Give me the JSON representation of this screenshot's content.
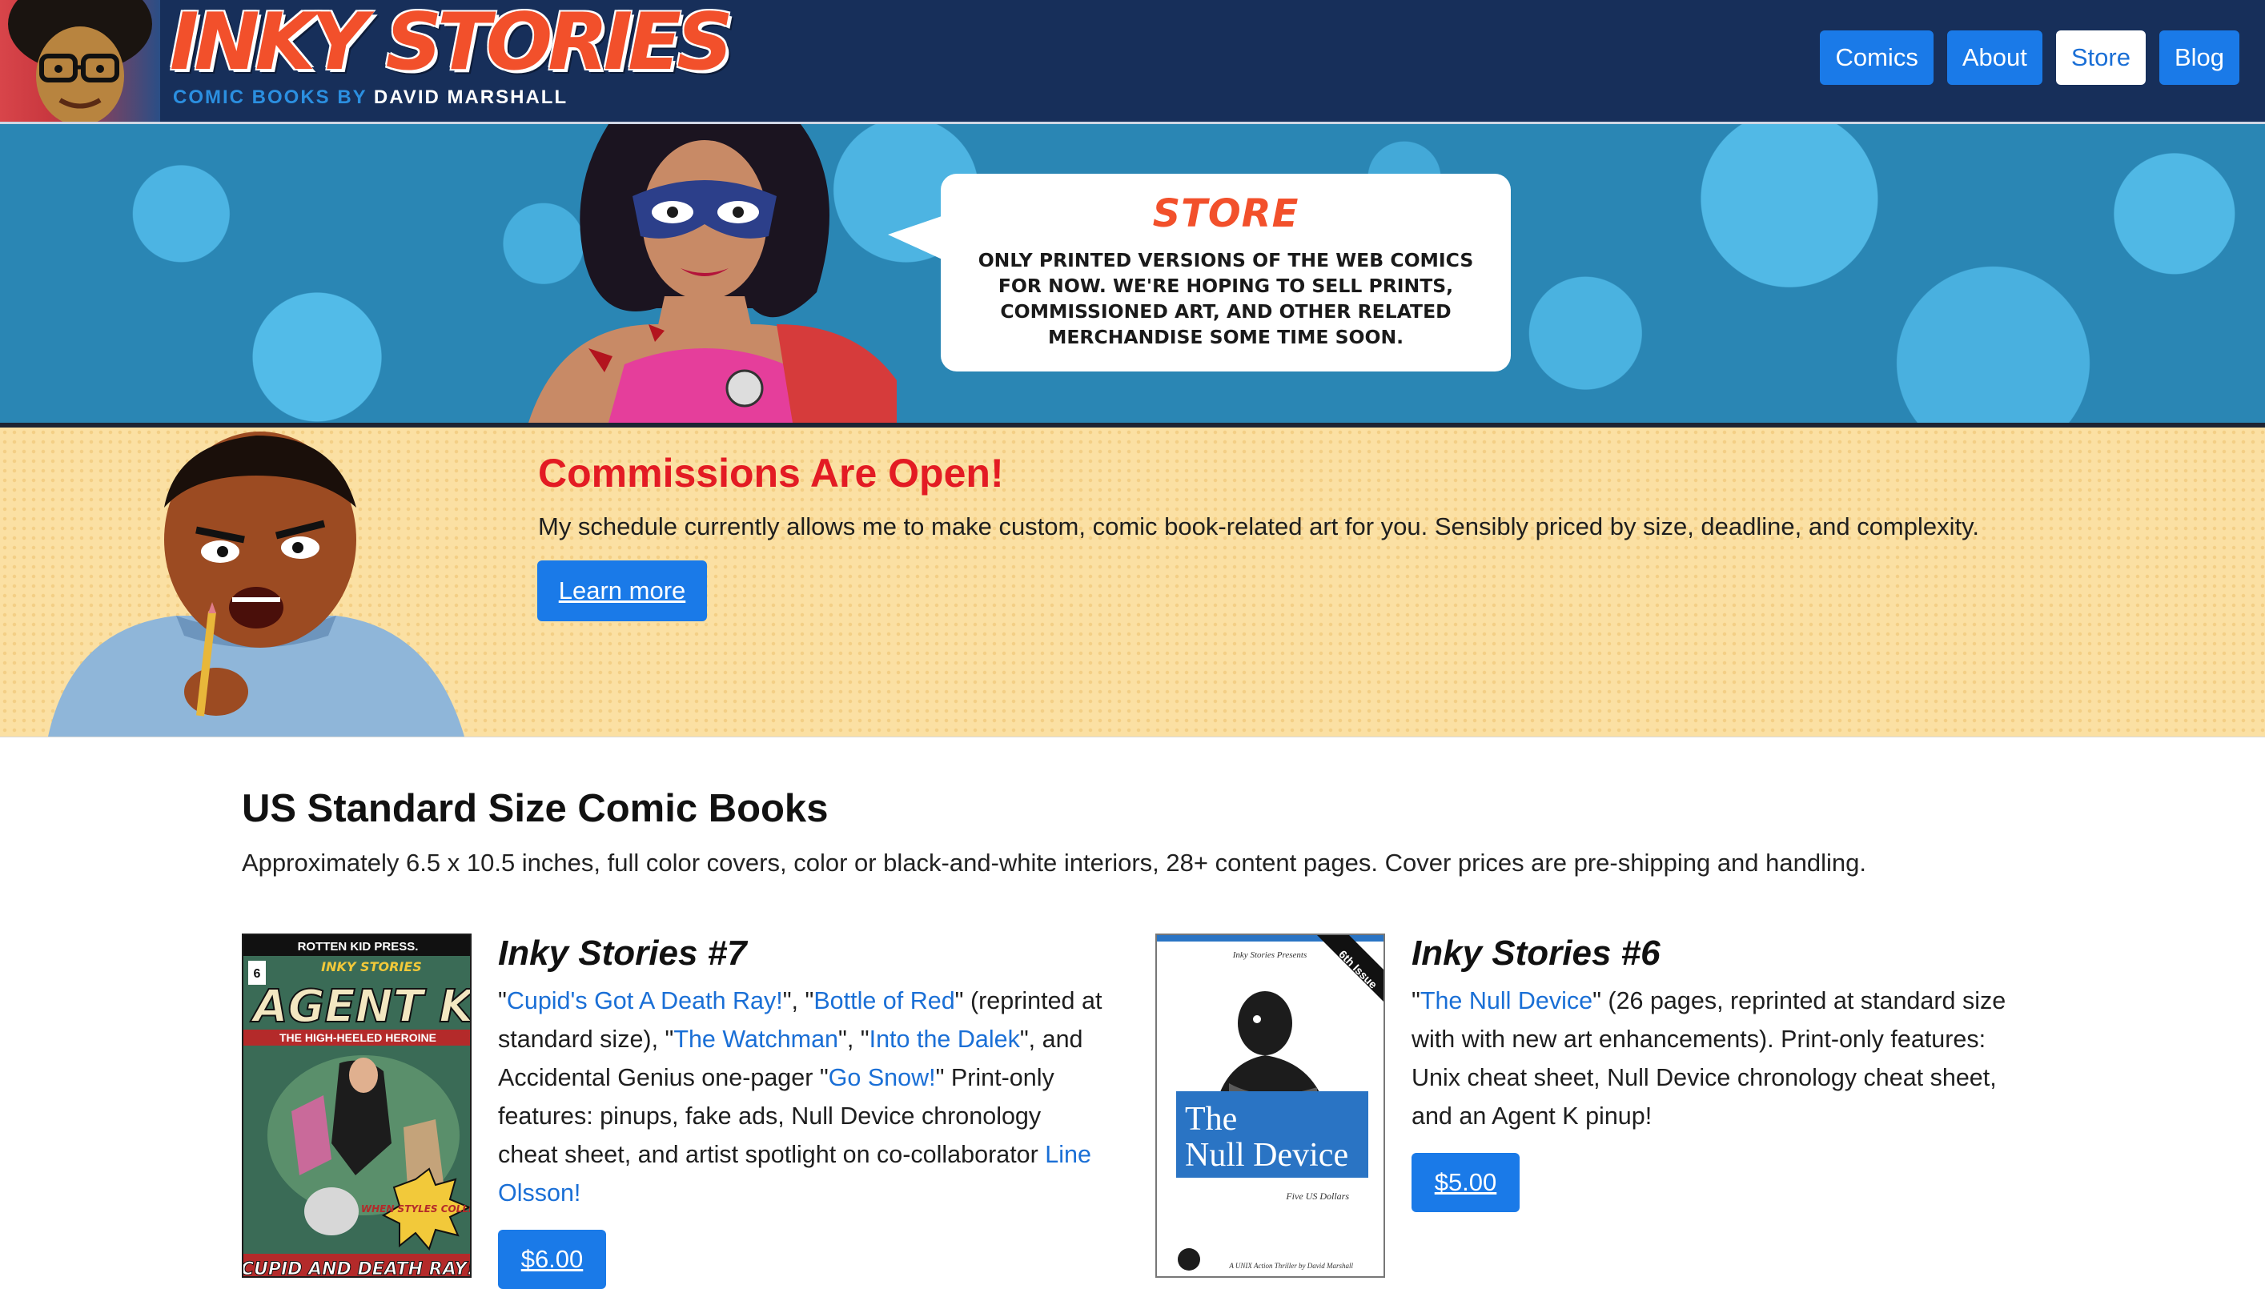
{
  "header": {
    "logo_title": "INKY STORIES",
    "logo_sub_prefix": "COMIC BOOKS BY",
    "logo_sub_name": "DAVID MARSHALL",
    "nav": [
      {
        "label": "Comics",
        "active": false
      },
      {
        "label": "About",
        "active": false
      },
      {
        "label": "Store",
        "active": true
      },
      {
        "label": "Blog",
        "active": false
      }
    ]
  },
  "hero": {
    "bubble_title": "STORE",
    "bubble_text": "ONLY PRINTED VERSIONS OF THE WEB COMICS FOR NOW. WE'RE HOPING TO SELL PRINTS, COMMISSIONED ART, AND OTHER RELATED MERCHANDISE SOME TIME SOON."
  },
  "commissions": {
    "title": "Commissions Are Open!",
    "text": "My schedule currently allows me to make custom, comic book-related art for you. Sensibly priced by size, deadline, and complexity.",
    "button": "Learn more"
  },
  "store": {
    "title": "US Standard Size Comic Books",
    "description": "Approximately 6.5 x 10.5 inches, full color covers, color or black-and-white interiors, 28+ content pages. Cover prices are pre-shipping and handling.",
    "products": [
      {
        "title": "Inky Stories #7",
        "price": "$6.00",
        "cover": {
          "publisher": "ROTTEN KID PRESS.",
          "series": "INKY STORIES",
          "hero": "AGENT K",
          "tagline": "THE HIGH-HEELED HEROINE",
          "burst": "WHEN STYLES COLLIDE!",
          "bottom": "CUPID AND DEATH RAY!",
          "issue": "6"
        },
        "desc": {
          "q1": "\"",
          "link1": "Cupid's Got A Death Ray!",
          "t1": "\", \"",
          "link2": "Bottle of Red",
          "t2": "\" (reprinted at standard size), \"",
          "link3": "The Watchman",
          "t3": "\", \"",
          "link4": "Into the Dalek",
          "t4": "\", and Accidental Genius one-pager \"",
          "link5": "Go Snow!",
          "t5": "\" Print-only features: pinups, fake ads, Null Device chronology cheat sheet, and artist spotlight on co-collaborator ",
          "link6": "Line Olsson!"
        }
      },
      {
        "title": "Inky Stories #6",
        "price": "$5.00",
        "cover": {
          "presents": "Inky Stories Presents",
          "ribbon": "6th Issue",
          "title_line1": "The",
          "title_line2": "Null Device",
          "price_line": "Five US Dollars",
          "footer": "A UNIX Action Thriller by David Marshall"
        },
        "desc": {
          "q1": "\"",
          "link1": "The Null Device",
          "t1": "\" (26 pages, reprinted at standard size with with new art enhancements). Print-only features: Unix cheat sheet, Null Device chronology cheat sheet, and an Agent K pinup!"
        }
      }
    ]
  }
}
